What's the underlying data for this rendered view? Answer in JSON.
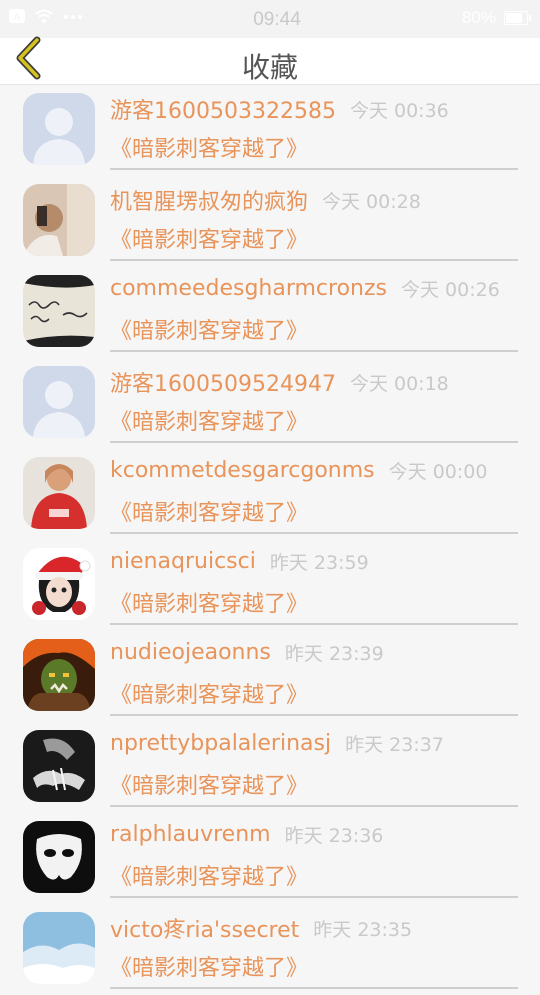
{
  "status_bar": {
    "time": "09:44",
    "battery": "80%"
  },
  "header": {
    "title": "收藏"
  },
  "colors": {
    "accent": "#e8945a",
    "back_icon": "#d6c21f",
    "muted": "#c9c9c9"
  },
  "items": [
    {
      "name": "游客1600503322585",
      "time": "今天 00:36",
      "book": "《暗影刺客穿越了》",
      "avatar": "default-avatar"
    },
    {
      "name": "机智腥塄叔匆的疯狗",
      "time": "今天 00:28",
      "book": "《暗影刺客穿越了》",
      "avatar": "photo-avatar"
    },
    {
      "name": "commeedesgharmcronzs",
      "time": "今天 00:26",
      "book": "《暗影刺客穿越了》",
      "avatar": "handwriting-avatar"
    },
    {
      "name": "游客1600509524947",
      "time": "今天 00:18",
      "book": "《暗影刺客穿越了》",
      "avatar": "default-avatar"
    },
    {
      "name": "kcommetdesgarcgonms",
      "time": "今天 00:00",
      "book": "《暗影刺客穿越了》",
      "avatar": "photo-avatar"
    },
    {
      "name": "nienaqruicsci",
      "time": "昨天 23:59",
      "book": "《暗影刺客穿越了》",
      "avatar": "santa-avatar"
    },
    {
      "name": "nudieojeaonns",
      "time": "昨天 23:39",
      "book": "《暗影刺客穿越了》",
      "avatar": "orc-avatar"
    },
    {
      "name": "nprettybpalalerinasj",
      "time": "昨天 23:37",
      "book": "《暗影刺客穿越了》",
      "avatar": "dark-photo-avatar"
    },
    {
      "name": "ralphlauvrenm",
      "time": "昨天 23:36",
      "book": "《暗影刺客穿越了》",
      "avatar": "mask-avatar"
    },
    {
      "name": "victo疼ria'ssecret",
      "time": "昨天 23:35",
      "book": "《暗影刺客穿越了》",
      "avatar": "sky-avatar"
    }
  ]
}
